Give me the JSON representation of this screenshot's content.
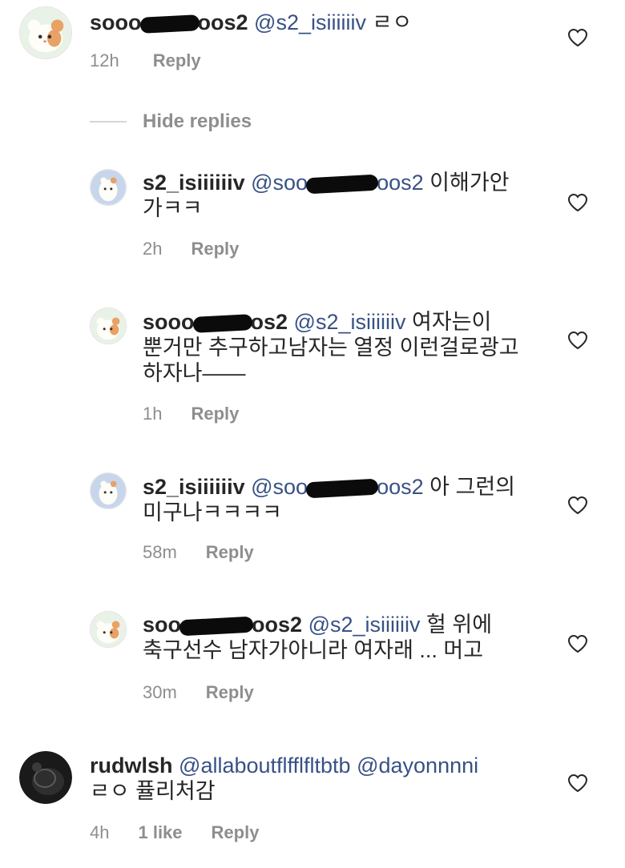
{
  "hide_replies_label": "Hide replies",
  "comments": [
    {
      "user_start": "sooo",
      "user_end": "oos2",
      "mention": "@s2_isiiiiiiv",
      "text_line1": "ㄹㅇ",
      "text_line2": "",
      "time": "12h",
      "likes": "",
      "reply_label": "Reply"
    },
    {
      "user": "s2_isiiiiiiv",
      "mention_start": "@soo",
      "mention_end": "oos2",
      "text_line1": "이해가안",
      "text_line2": "가ㅋㅋ",
      "time": "2h",
      "likes": "",
      "reply_label": "Reply"
    },
    {
      "user_start": "sooo",
      "user_end": "os2",
      "mention": "@s2_isiiiiiiv",
      "text_line1": "여자는이",
      "text_line2": "뿐거만 추구하고남자는 열정 이런걸로광고",
      "text_line3": "하자나——",
      "time": "1h",
      "likes": "",
      "reply_label": "Reply"
    },
    {
      "user": "s2_isiiiiiiv",
      "mention_start": "@soo",
      "mention_end": "oos2",
      "text_line1": "아 그런의",
      "text_line2": "미구나ㅋㅋㅋㅋ",
      "time": "58m",
      "likes": "",
      "reply_label": "Reply"
    },
    {
      "user_start": "soo",
      "user_end": "oos2",
      "mention": "@s2_isiiiiiiv",
      "text_line1": "헐 위에",
      "text_line2": "축구선수 남자가아니라 여자래 ... 머고",
      "time": "30m",
      "likes": "",
      "reply_label": "Reply"
    },
    {
      "user": "rudwlsh",
      "mention1": "@allaboutflfflfltbtb",
      "mention2": "@dayonnnni",
      "text_line2": "ㄹㅇ 퓰리처감",
      "time": "4h",
      "likes": "1 like",
      "reply_label": "Reply"
    }
  ],
  "colors": {
    "text": "#262626",
    "mention": "#385185",
    "meta": "#8e8e8e",
    "heart": "#262626"
  },
  "icons": [
    "hamster-avatar",
    "dark-avatar",
    "heart-outline-icon"
  ]
}
